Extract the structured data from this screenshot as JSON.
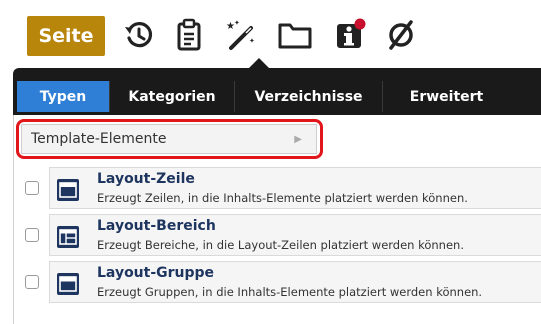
{
  "toolbar": {
    "page_button": "Seite",
    "icons": [
      "history-icon",
      "clipboard-icon",
      "magic-wand-icon",
      "folder-icon",
      "info-icon",
      "empty-set-icon"
    ],
    "info_badge_color": "#c8102e",
    "page_button_color": "#b8860b"
  },
  "tabs": [
    {
      "label": "Typen",
      "active": true
    },
    {
      "label": "Kategorien",
      "active": false
    },
    {
      "label": "Verzeichnisse",
      "active": false
    },
    {
      "label": "Erweitert",
      "active": false
    }
  ],
  "breadcrumb": {
    "label": "Template-Elemente"
  },
  "elements": [
    {
      "title": "Layout-Zeile",
      "description": "Erzeugt Zeilen, in die Inhalts-Elemente platziert werden können.",
      "icon": "layout-row-icon"
    },
    {
      "title": "Layout-Bereich",
      "description": "Erzeugt Bereiche, in die Layout-Zeilen platziert werden können.",
      "icon": "layout-area-icon"
    },
    {
      "title": "Layout-Gruppe",
      "description": "Erzeugt Gruppen, in die Inhalts-Elemente platziert werden können.",
      "icon": "layout-group-icon"
    }
  ],
  "colors": {
    "active_tab": "#2f7fd6",
    "panel": "#1a1a1a",
    "highlight": "#e0161b",
    "item_title": "#1e3560"
  }
}
